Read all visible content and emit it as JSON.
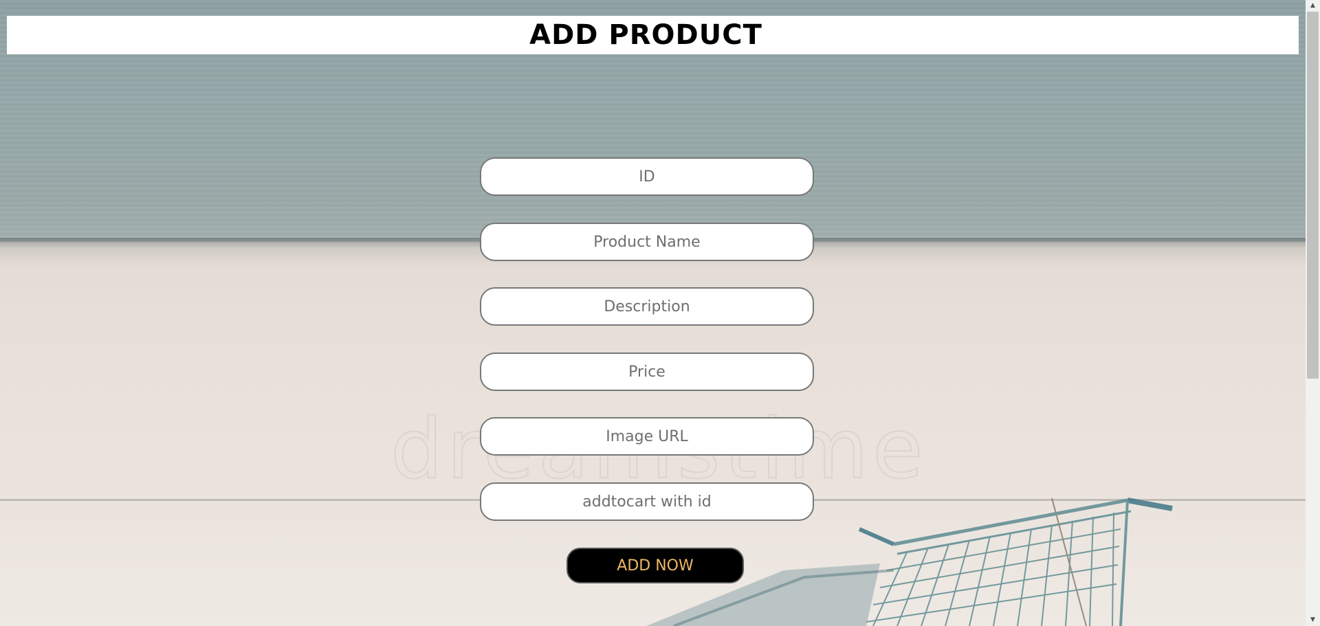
{
  "header": {
    "title": "ADD PRODUCT"
  },
  "background": {
    "watermark_text": "dreamstime"
  },
  "form": {
    "fields": [
      {
        "placeholder": "ID",
        "value": ""
      },
      {
        "placeholder": "Product Name",
        "value": ""
      },
      {
        "placeholder": "Description",
        "value": ""
      },
      {
        "placeholder": "Price",
        "value": ""
      },
      {
        "placeholder": "Image URL",
        "value": ""
      },
      {
        "placeholder": "addtocart with id",
        "value": ""
      }
    ],
    "submit_label": "ADD NOW"
  },
  "colors": {
    "button_bg": "#000000",
    "button_text": "#f0b765",
    "header_bg": "#ffffff"
  },
  "icons": {
    "scroll_up": "scroll-up-arrow-icon",
    "scroll_down": "scroll-down-arrow-icon"
  }
}
